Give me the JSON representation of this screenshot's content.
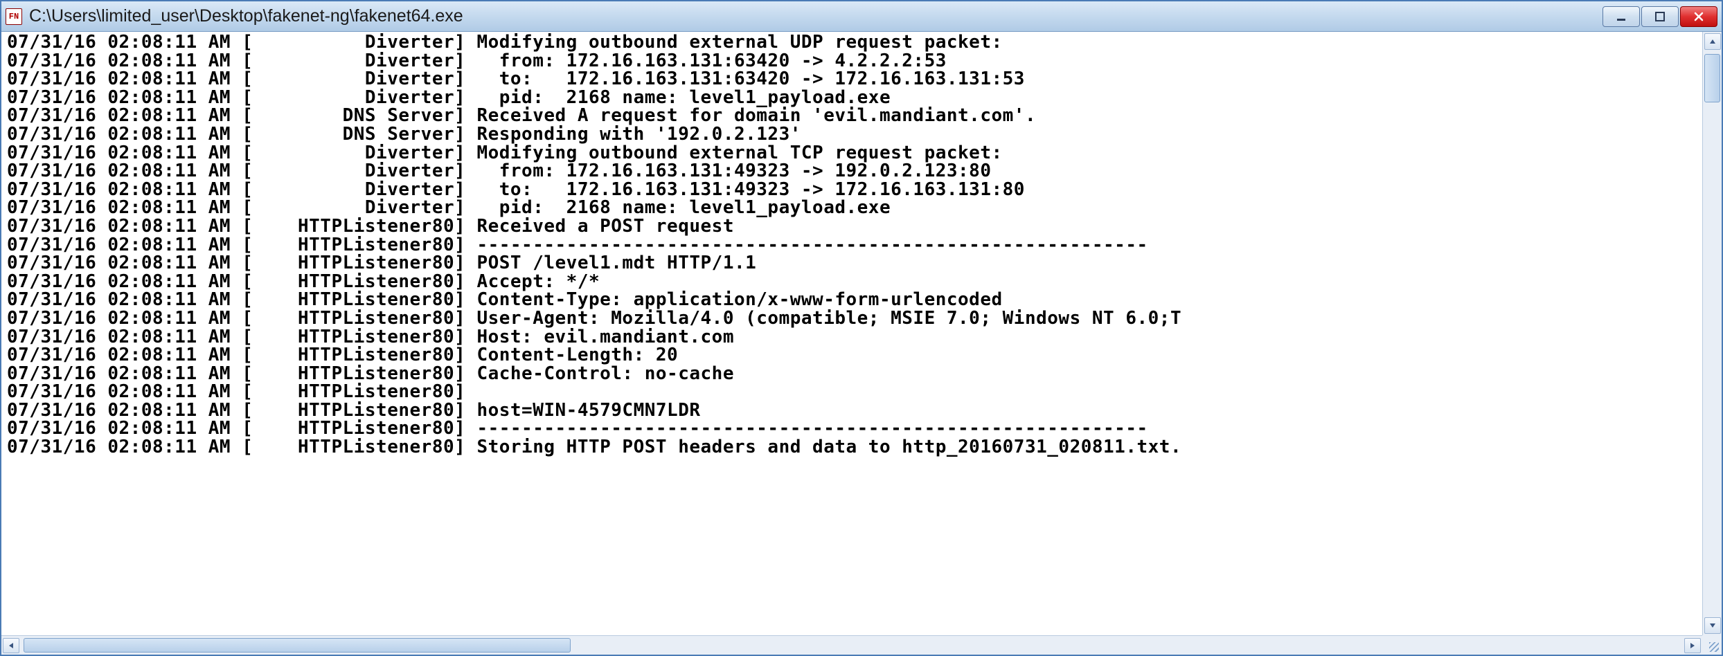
{
  "window": {
    "title": "C:\\Users\\limited_user\\Desktop\\fakenet-ng\\fakenet64.exe",
    "icon_label": "FN"
  },
  "log": {
    "lines": [
      "07/31/16 02:08:11 AM [          Diverter] Modifying outbound external UDP request packet:",
      "07/31/16 02:08:11 AM [          Diverter]   from: 172.16.163.131:63420 -> 4.2.2.2:53",
      "07/31/16 02:08:11 AM [          Diverter]   to:   172.16.163.131:63420 -> 172.16.163.131:53",
      "07/31/16 02:08:11 AM [          Diverter]   pid:  2168 name: level1_payload.exe",
      "07/31/16 02:08:11 AM [        DNS Server] Received A request for domain 'evil.mandiant.com'.",
      "07/31/16 02:08:11 AM [        DNS Server] Responding with '192.0.2.123'",
      "07/31/16 02:08:11 AM [          Diverter] Modifying outbound external TCP request packet:",
      "07/31/16 02:08:11 AM [          Diverter]   from: 172.16.163.131:49323 -> 192.0.2.123:80",
      "07/31/16 02:08:11 AM [          Diverter]   to:   172.16.163.131:49323 -> 172.16.163.131:80",
      "07/31/16 02:08:11 AM [          Diverter]   pid:  2168 name: level1_payload.exe",
      "07/31/16 02:08:11 AM [    HTTPListener80] Received a POST request",
      "07/31/16 02:08:11 AM [    HTTPListener80] ------------------------------------------------------------",
      "07/31/16 02:08:11 AM [    HTTPListener80] POST /level1.mdt HTTP/1.1",
      "07/31/16 02:08:11 AM [    HTTPListener80] Accept: */*",
      "07/31/16 02:08:11 AM [    HTTPListener80] Content-Type: application/x-www-form-urlencoded",
      "07/31/16 02:08:11 AM [    HTTPListener80] User-Agent: Mozilla/4.0 (compatible; MSIE 7.0; Windows NT 6.0;T",
      "07/31/16 02:08:11 AM [    HTTPListener80] Host: evil.mandiant.com",
      "07/31/16 02:08:11 AM [    HTTPListener80] Content-Length: 20",
      "07/31/16 02:08:11 AM [    HTTPListener80] Cache-Control: no-cache",
      "07/31/16 02:08:11 AM [    HTTPListener80]",
      "07/31/16 02:08:11 AM [    HTTPListener80] host=WIN-4579CMN7LDR",
      "07/31/16 02:08:11 AM [    HTTPListener80] ------------------------------------------------------------",
      "07/31/16 02:08:11 AM [    HTTPListener80] Storing HTTP POST headers and data to http_20160731_020811.txt."
    ]
  }
}
